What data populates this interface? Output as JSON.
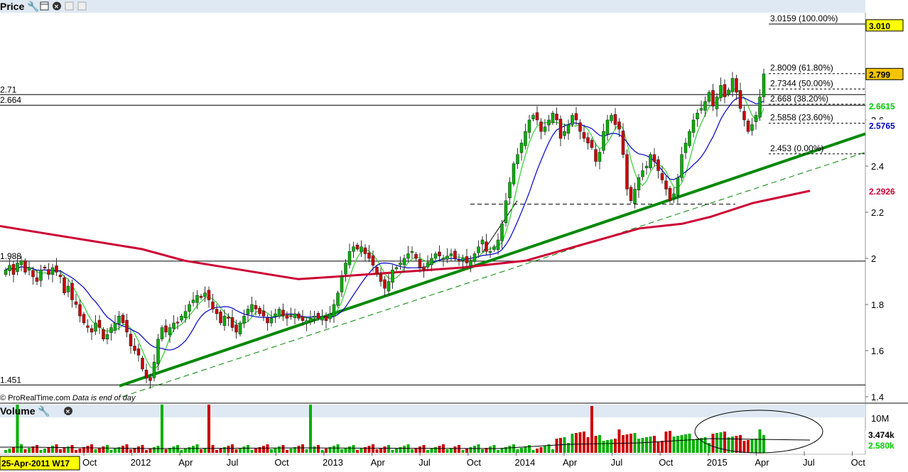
{
  "price_panel": {
    "title": "Price",
    "source_note": "© ProRealTime.com",
    "source_note_italic": "Data is end of day",
    "tool_icons": [
      "wrench-icon",
      "window-icon",
      "close-icon",
      "expand-icon",
      "collapse-icon"
    ]
  },
  "volume_panel": {
    "title": "Volume",
    "tool_icons": [
      "wrench-icon",
      "close-icon"
    ],
    "axis_label_10m": "10M",
    "tag_ma": "3.474k",
    "tag_vol": "2.580k"
  },
  "cursor_date": "25-Apr-2011 W17",
  "price_tags": [
    {
      "text": "3.010",
      "value": 3.01,
      "bg": "#ffff00",
      "color": "#000000"
    },
    {
      "text": "2.799",
      "value": 2.799,
      "bg": "#f5c400",
      "color": "#000000"
    },
    {
      "text": "2.6615",
      "value": 2.6615,
      "bg": "#ffffff",
      "color": "#00cc00"
    },
    {
      "text": "2.5765",
      "value": 2.5765,
      "bg": "#ffffff",
      "color": "#0000cc"
    },
    {
      "text": "2.2926",
      "value": 2.2926,
      "bg": "#ffffff",
      "color": "#cc0033"
    }
  ],
  "left_levels": [
    {
      "text": "2.71",
      "value": 2.71
    },
    {
      "text": "2.664",
      "value": 2.664
    },
    {
      "text": "1.988",
      "value": 1.988
    },
    {
      "text": "1.451",
      "value": 1.451
    }
  ],
  "fibonacci": [
    {
      "text": "3.0159 (100.00%)",
      "value": 3.0159
    },
    {
      "text": "2.8009 (61.80%)",
      "value": 2.8009
    },
    {
      "text": "2.7344 (50.00%)",
      "value": 2.7344
    },
    {
      "text": "2.668 (38.20%)",
      "value": 2.668
    },
    {
      "text": "2.5858 (23.60%)",
      "value": 2.5858
    },
    {
      "text": "2.453 (0.00%)",
      "value": 2.453
    }
  ],
  "colors": {
    "up": "#00b000",
    "down": "#cc0000",
    "ma20": "#33cc33",
    "ma50": "#0000cc",
    "ma200": "#cc0033",
    "trendline": "#008800"
  },
  "chart_data": {
    "type": "candlestick",
    "ylim": [
      1.4,
      3.1
    ],
    "y_ticks": [
      "1.4",
      "1.6",
      "1.8",
      "2",
      "2.2",
      "2.4",
      "2.6"
    ],
    "x_ticks": [
      "Oct",
      "2012",
      "Apr",
      "Jul",
      "Oct",
      "2013",
      "Apr",
      "Jul",
      "Oct",
      "2014",
      "Apr",
      "Jul",
      "Oct",
      "2015",
      "Apr",
      "Jul",
      "Oct"
    ],
    "close": [
      1.95,
      1.97,
      1.93,
      1.98,
      1.99,
      1.94,
      1.96,
      1.92,
      1.9,
      1.95,
      1.96,
      1.93,
      1.96,
      1.94,
      1.92,
      1.85,
      1.88,
      1.82,
      1.8,
      1.75,
      1.72,
      1.7,
      1.68,
      1.72,
      1.7,
      1.65,
      1.67,
      1.7,
      1.72,
      1.75,
      1.72,
      1.68,
      1.62,
      1.6,
      1.58,
      1.52,
      1.48,
      1.47,
      1.55,
      1.65,
      1.7,
      1.68,
      1.7,
      1.72,
      1.72,
      1.75,
      1.77,
      1.8,
      1.82,
      1.84,
      1.83,
      1.85,
      1.82,
      1.78,
      1.76,
      1.72,
      1.75,
      1.74,
      1.7,
      1.68,
      1.72,
      1.75,
      1.78,
      1.8,
      1.78,
      1.76,
      1.75,
      1.72,
      1.74,
      1.76,
      1.78,
      1.75,
      1.74,
      1.75,
      1.76,
      1.74,
      1.73,
      1.73,
      1.74,
      1.75,
      1.74,
      1.75,
      1.73,
      1.76,
      1.8,
      1.85,
      1.92,
      1.98,
      2.03,
      2.05,
      2.04,
      2.05,
      2.02,
      2.0,
      1.97,
      1.93,
      1.9,
      1.87,
      1.9,
      1.95,
      1.96,
      1.98,
      2.0,
      2.02,
      2.03,
      2.0,
      1.96,
      1.95,
      1.98,
      2.0,
      2.02,
      2.01,
      2.0,
      2.01,
      2.02,
      2.0,
      1.99,
      2.0,
      1.98,
      1.99,
      2.02,
      2.05,
      2.08,
      2.03,
      2.03,
      2.05,
      2.08,
      2.15,
      2.25,
      2.33,
      2.41,
      2.45,
      2.5,
      2.55,
      2.6,
      2.62,
      2.6,
      2.55,
      2.57,
      2.6,
      2.63,
      2.6,
      2.52,
      2.55,
      2.58,
      2.62,
      2.6,
      2.55,
      2.52,
      2.5,
      2.48,
      2.42,
      2.46,
      2.55,
      2.6,
      2.62,
      2.58,
      2.56,
      2.45,
      2.3,
      2.25,
      2.3,
      2.35,
      2.38,
      2.4,
      2.45,
      2.42,
      2.38,
      2.34,
      2.3,
      2.25,
      2.28,
      2.35,
      2.45,
      2.5,
      2.55,
      2.6,
      2.63,
      2.65,
      2.68,
      2.72,
      2.66,
      2.7,
      2.75,
      2.7,
      2.73,
      2.78,
      2.72,
      2.65,
      2.6,
      2.55,
      2.58,
      2.62,
      2.7,
      2.8
    ],
    "ma20_end": 2.6615,
    "ma50_end": 2.5765,
    "ma200_end": 2.2926
  }
}
